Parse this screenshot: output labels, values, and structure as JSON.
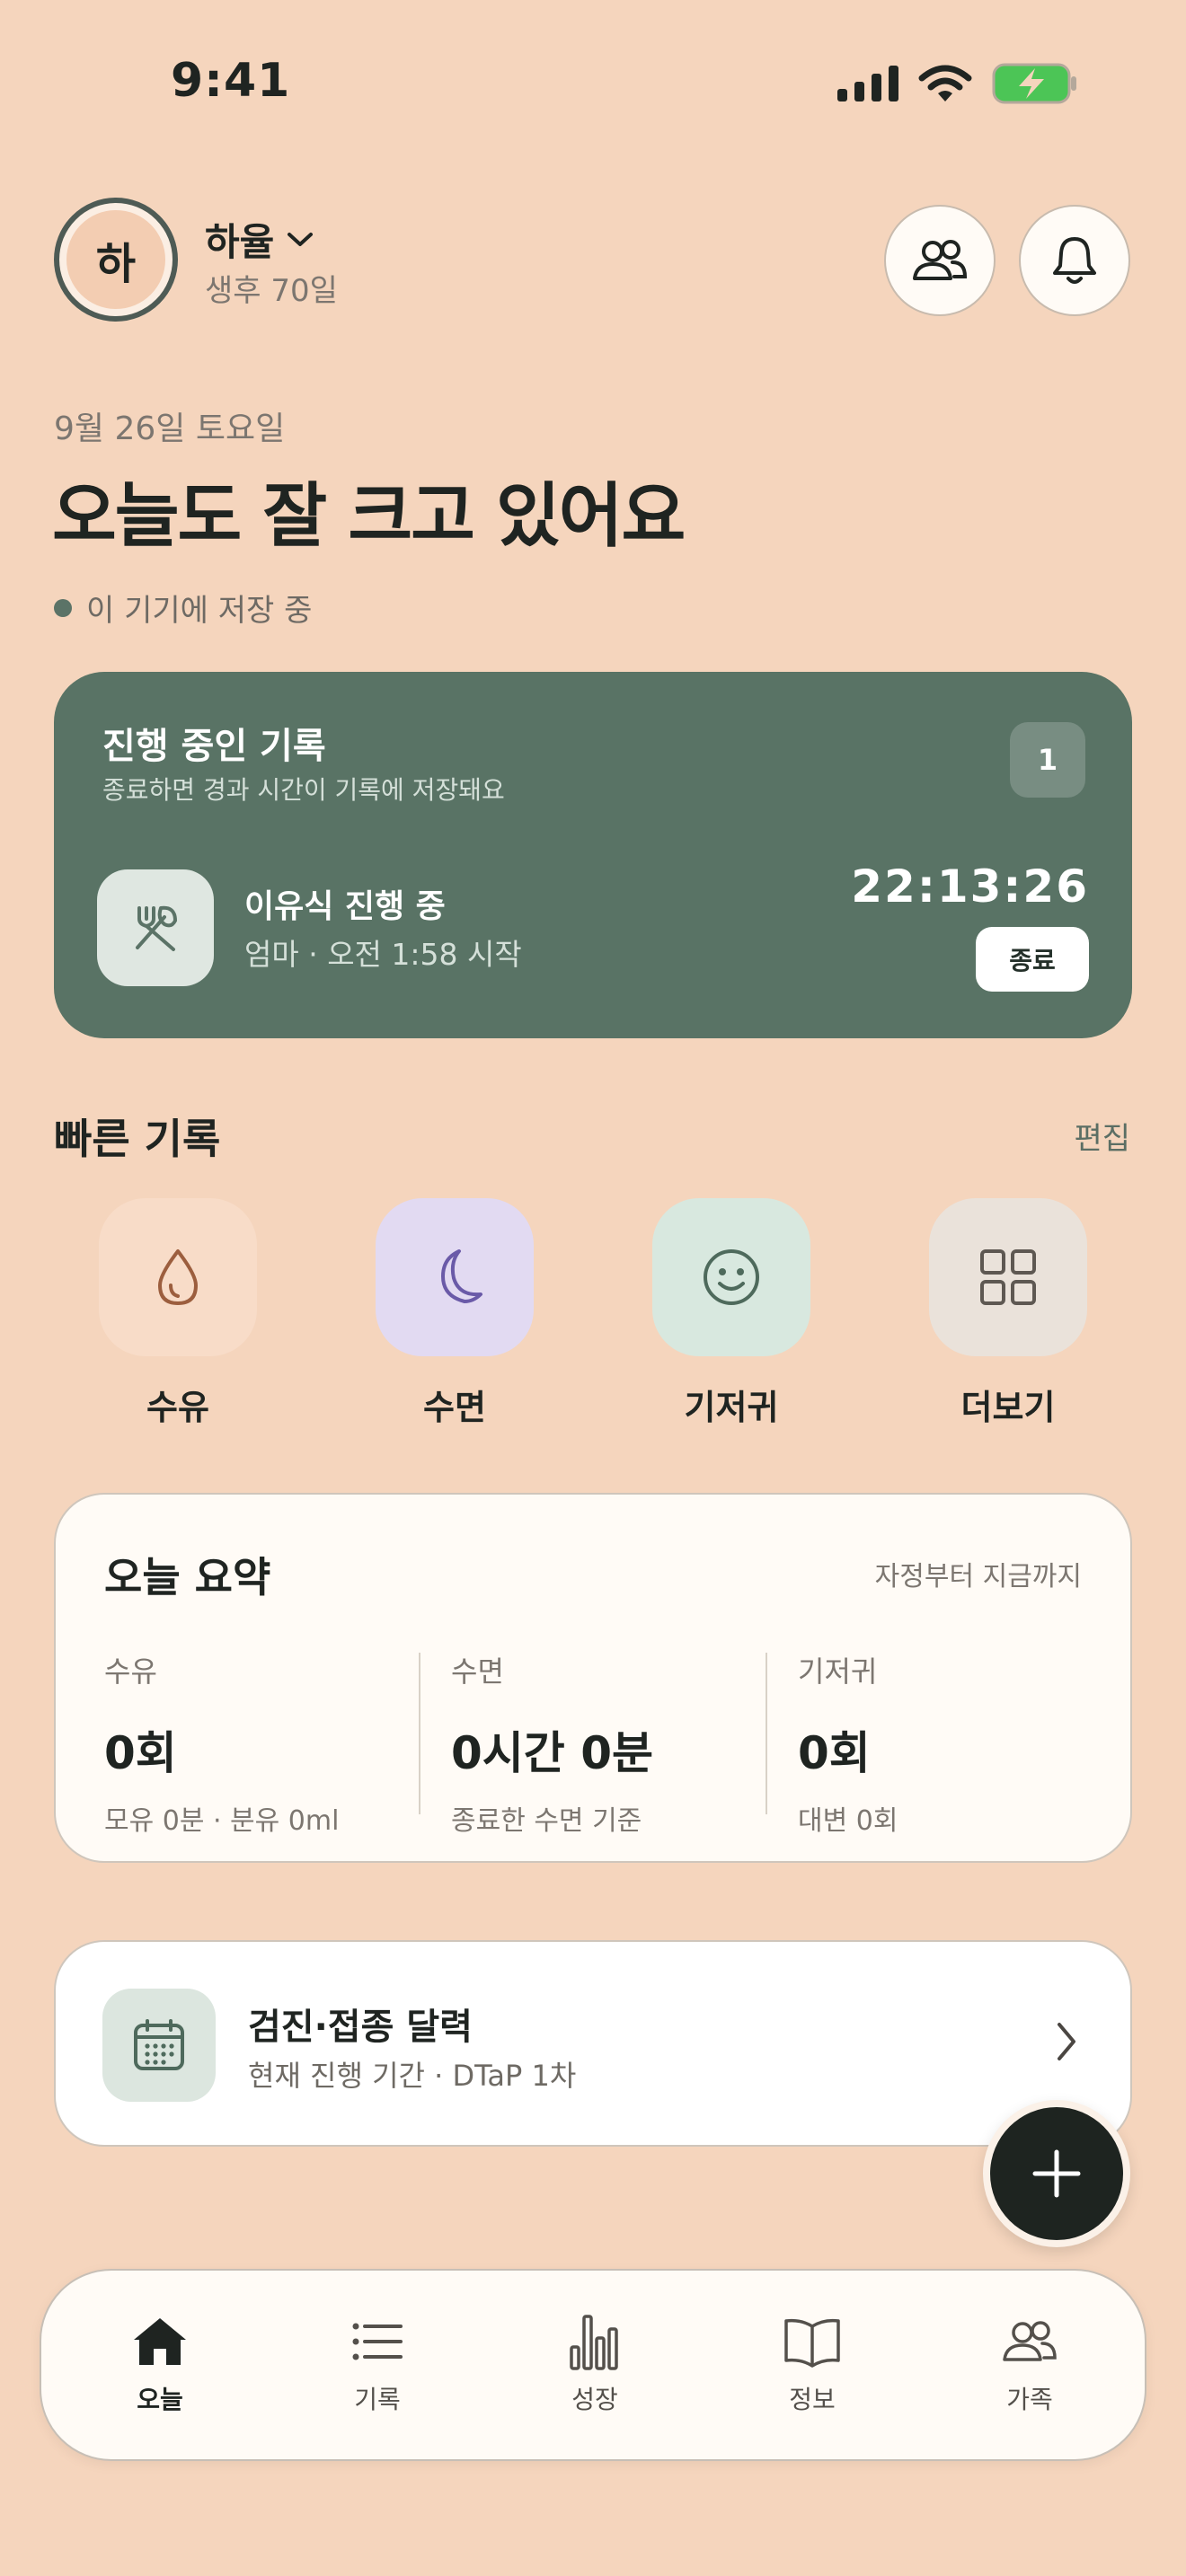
{
  "status_bar": {
    "time": "9:41"
  },
  "header": {
    "avatar_initial": "하",
    "child_name": "하율",
    "child_age": "생후 70일"
  },
  "date": "9월 26일 토요일",
  "headline": "오늘도 잘 크고 있어요",
  "storage_status": "이 기기에 저장 중",
  "ongoing": {
    "title": "진행 중인 기록",
    "subtitle": "종료하면 경과 시간이 기록에 저장돼요",
    "count": "1",
    "activity_title": "이유식 진행 중",
    "activity_meta": "엄마 · 오전 1:58 시작",
    "timer": "22:13:26",
    "end_label": "종료"
  },
  "quick": {
    "title": "빠른 기록",
    "edit_label": "편집",
    "items": [
      {
        "label": "수유",
        "icon": "drop-icon",
        "bg": "#F8DCC8"
      },
      {
        "label": "수면",
        "icon": "moon-icon",
        "bg": "#E2DAF2"
      },
      {
        "label": "기저귀",
        "icon": "smile-icon",
        "bg": "#D8E8DF"
      },
      {
        "label": "더보기",
        "icon": "grid-icon",
        "bg": "#EAE2DA"
      }
    ]
  },
  "summary": {
    "title": "오늘 요약",
    "range": "자정부터 지금까지",
    "columns": [
      {
        "label": "수유",
        "value": "0회",
        "note": "모유 0분 · 분유 0ml"
      },
      {
        "label": "수면",
        "value": "0시간 0분",
        "note": "종료한 수면 기준"
      },
      {
        "label": "기저귀",
        "value": "0회",
        "note": "대변 0회"
      }
    ]
  },
  "calendar": {
    "title": "검진·접종 달력",
    "subtitle": "현재 진행 기간 · DTaP 1차"
  },
  "tabs": [
    {
      "label": "오늘",
      "icon": "home-icon",
      "active": true
    },
    {
      "label": "기록",
      "icon": "list-icon",
      "active": false
    },
    {
      "label": "성장",
      "icon": "bar-chart-icon",
      "active": false
    },
    {
      "label": "정보",
      "icon": "book-icon",
      "active": false
    },
    {
      "label": "가족",
      "icon": "people-icon",
      "active": false
    }
  ],
  "colors": {
    "background": "#F5D5BD",
    "accent_green": "#597365",
    "card": "#FFFBF6",
    "dark": "#1E2420"
  }
}
